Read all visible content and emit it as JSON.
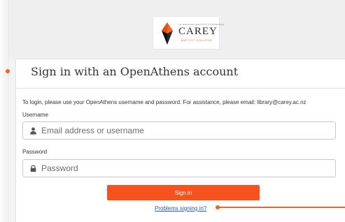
{
  "brand": {
    "small_text": "TE WANANGA BAPTIST O AOTEAROA",
    "name": "CAREY",
    "subtitle": "BAPTIST COLLEGE",
    "colors": {
      "accent": "#f5521d",
      "dark": "#2a2a2a"
    }
  },
  "card": {
    "title": "Sign in with an OpenAthens account",
    "instructions": "To login, please use your OpenAthens username and password. For assistance, please email: library@carey.ac.nz"
  },
  "form": {
    "username_label": "Username",
    "username_placeholder": "Email address or username",
    "username_value": "",
    "username_icon": "user-icon",
    "password_label": "Password",
    "password_placeholder": "Password",
    "password_value": "",
    "password_icon": "lock-icon",
    "signin_label": "Sign in",
    "help_link": "Problems signing in?"
  },
  "colors": {
    "button": "#f5521d",
    "link": "#1f5fbf",
    "annotation": "#f06423"
  }
}
